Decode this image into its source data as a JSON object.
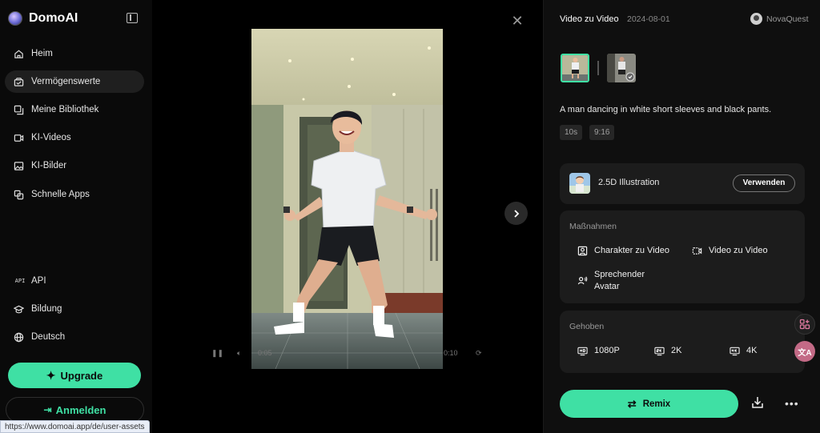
{
  "brand": {
    "name": "DomoAI"
  },
  "sidebar": {
    "items": [
      {
        "label": "Heim",
        "icon": "home-icon"
      },
      {
        "label": "Vermögenswerte",
        "icon": "assets-icon",
        "active": true
      },
      {
        "label": "Meine Bibliothek",
        "icon": "library-icon"
      },
      {
        "label": "KI-Videos",
        "icon": "video-icon"
      },
      {
        "label": "KI-Bilder",
        "icon": "image-icon"
      },
      {
        "label": "Schnelle Apps",
        "icon": "apps-icon"
      }
    ],
    "bottom_items": [
      {
        "label": "API",
        "icon": "api-icon"
      },
      {
        "label": "Bildung",
        "icon": "education-icon"
      },
      {
        "label": "Deutsch",
        "icon": "globe-icon"
      }
    ],
    "upgrade_label": "Upgrade",
    "login_label": "Anmelden",
    "status_url": "https://www.domoai.app/de/user-assets"
  },
  "viewer": {
    "time_current": "0:05",
    "time_total": "0:10"
  },
  "panel": {
    "title": "Video zu Video",
    "date": "2024-08-01",
    "user": "NovaQuest",
    "description": "A man dancing in white short sleeves and black pants.",
    "chips": [
      "10s",
      "9:16"
    ],
    "style": {
      "name": "2.5D Illustration",
      "use_label": "Verwenden"
    },
    "actions": {
      "title": "Maßnahmen",
      "items": [
        {
          "label": "Charakter zu Video",
          "icon": "portrait-icon"
        },
        {
          "label": "Video zu Video",
          "icon": "video-to-video-icon"
        },
        {
          "label_line1": "Sprechender",
          "label_line2": "Avatar",
          "icon": "talking-avatar-icon"
        }
      ]
    },
    "enhanced": {
      "title": "Gehoben",
      "items": [
        {
          "label": "1080P",
          "icon": "hd-icon"
        },
        {
          "label": "2K",
          "icon": "2k-icon"
        },
        {
          "label": "4K",
          "icon": "4k-icon"
        }
      ]
    },
    "remix_label": "Remix"
  },
  "colors": {
    "accent": "#3fe0a4",
    "background": "#000000",
    "panel": "#0f0f0f",
    "card": "#1c1c1c"
  }
}
